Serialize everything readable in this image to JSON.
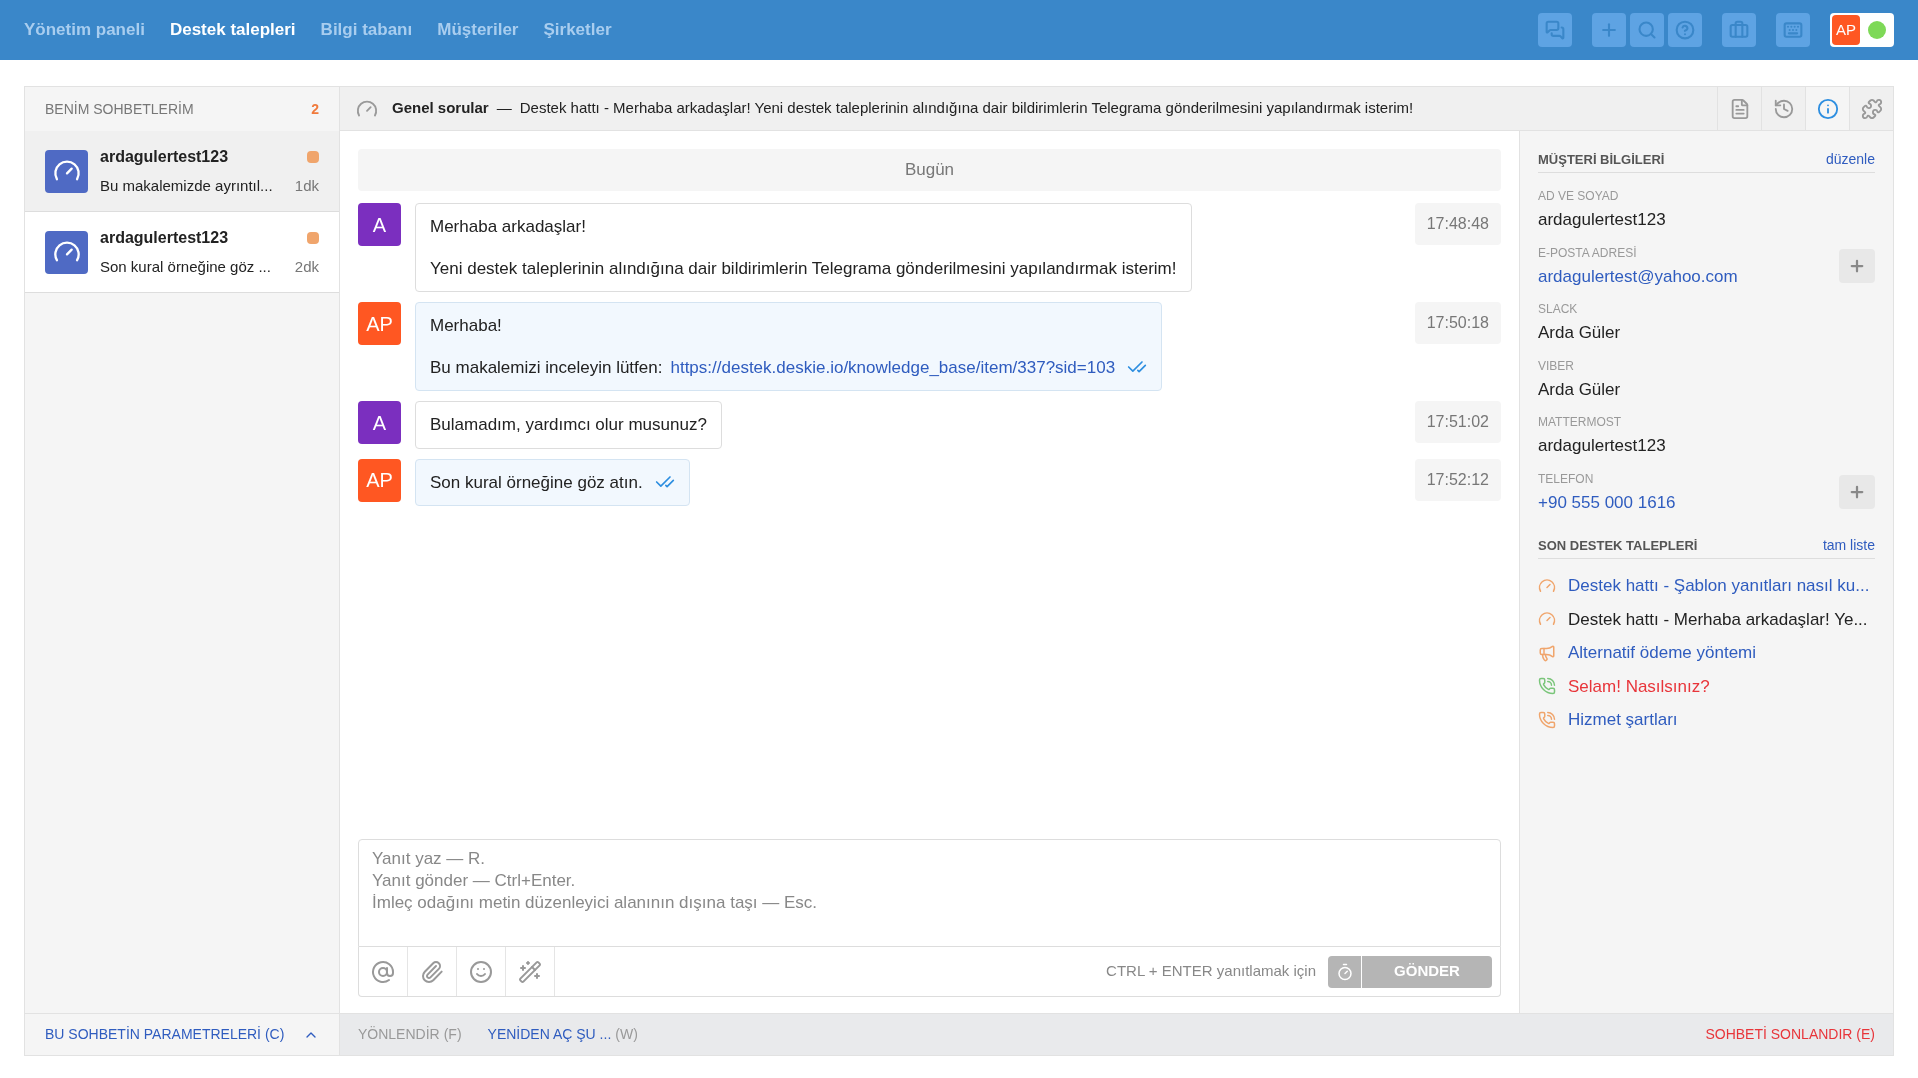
{
  "nav": {
    "items": [
      {
        "label": "Yönetim paneli",
        "selected": false
      },
      {
        "label": "Destek talepleri",
        "selected": true
      },
      {
        "label": "Bilgi tabanı",
        "selected": false
      },
      {
        "label": "Müşteriler",
        "selected": false
      },
      {
        "label": "Şirketler",
        "selected": false
      }
    ],
    "user": {
      "initials": "AP",
      "online": true
    }
  },
  "sidebar": {
    "title": "BENİM SOHBETLERİM",
    "count": "2",
    "chats": [
      {
        "name": "ardagulertest123",
        "preview": "Bu makalemizde ayrıntıl...",
        "time": "1dk",
        "unread": true,
        "selected": false
      },
      {
        "name": "ardagulertest123",
        "preview": "Son kural örneğine göz ...",
        "time": "2dk",
        "unread": true,
        "selected": true
      }
    ]
  },
  "header": {
    "category": "Genel sorular",
    "separator": "—",
    "subject": "Destek hattı - Merhaba arkadaşlar! Yeni destek taleplerinin alındığına dair bildirimlerin Telegrama gönderilmesini yapılandırmak isterim!",
    "panel_tabs": [
      {
        "kind": "document",
        "selected": false
      },
      {
        "kind": "history",
        "selected": false
      },
      {
        "kind": "info",
        "selected": true
      },
      {
        "kind": "plugin",
        "selected": false
      }
    ]
  },
  "chat": {
    "day": "Bugün",
    "messages": [
      {
        "kind": "customer",
        "avatar": "A",
        "paragraphs": [
          {
            "text": "Merhaba arkadaşlar!"
          },
          {
            "text": "Yeni destek taleplerinin alındığına dair bildirimlerin Telegrama gönderilmesini yapılandırmak isterim!"
          }
        ],
        "time": "17:48:48",
        "read": false
      },
      {
        "kind": "agent",
        "avatar": "AP",
        "paragraphs": [
          {
            "text": "Merhaba!"
          },
          {
            "text": "Bu makalemizi inceleyin lütfen:",
            "link": "https://destek.deskie.io/knowledge_base/item/337?sid=103"
          }
        ],
        "time": "17:50:18",
        "read": true
      },
      {
        "kind": "customer",
        "avatar": "A",
        "paragraphs": [
          {
            "text": "Bulamadım, yardımcı olur musunuz?"
          }
        ],
        "time": "17:51:02",
        "read": false
      },
      {
        "kind": "agent",
        "avatar": "AP",
        "paragraphs": [
          {
            "text": "Son kural örneğine göz atın."
          }
        ],
        "time": "17:52:12",
        "read": true
      }
    ]
  },
  "composer": {
    "placeholder": "Yanıt yaz — R.\nYanıt gönder — Ctrl+Enter.\nİmleç odağını metin düzenleyici alanının dışına taşı — Esc.",
    "hint": "CTRL + ENTER yanıtlamak için",
    "send": {
      "label": "GÖNDER",
      "disabled": true
    }
  },
  "customer_info": {
    "title": "MÜŞTERİ BİLGİLERİ",
    "edit": "düzenle",
    "fields": [
      {
        "label": "AD VE SOYAD",
        "value": "ardagulertest123",
        "kind": "text"
      },
      {
        "label": "E-POSTA ADRESİ",
        "value": "ardagulertest@yahoo.com",
        "kind": "link"
      },
      {
        "label": "SLACK",
        "value": "Arda Güler",
        "kind": "text"
      },
      {
        "label": "VIBER",
        "value": "Arda Güler",
        "kind": "text"
      },
      {
        "label": "MATTERMOST",
        "value": "ardagulertest123",
        "kind": "text"
      },
      {
        "label": "TELEFON",
        "value": "+90 555 000 1616",
        "kind": "link"
      }
    ]
  },
  "recent_tickets": {
    "title": "SON DESTEK TALEPLERİ",
    "full_list": "tam liste",
    "items": [
      {
        "kind": "chat",
        "title": "Destek hattı - Şablon yanıtları nasıl ku...",
        "color": "#2f5cbf",
        "active": false
      },
      {
        "kind": "chat",
        "title": "Destek hattı - Merhaba arkadaşlar! Ye...",
        "color": "#222222",
        "active": false
      },
      {
        "kind": "announcement",
        "title": "Alternatif ödeme yöntemi",
        "color": "#2f5cbf",
        "active": false
      },
      {
        "kind": "viber",
        "title": "Selam! Nasılsınız?",
        "color": "#e8353a",
        "active": true
      },
      {
        "kind": "viber",
        "title": "Hizmet şartları",
        "color": "#2f5cbf",
        "active": false
      }
    ]
  },
  "footer": {
    "parameters": {
      "label": "BU SOHBETİN PARAMETRELERİ (C)",
      "expanded": false
    },
    "actions": [
      {
        "label": "YÖNLENDİR",
        "shortcut": "(F)",
        "disabled": true
      },
      {
        "label": "YENİDEN AÇ ŞU ...",
        "shortcut": "(W)",
        "disabled": false
      }
    ],
    "end": {
      "label": "SOHBETİ SONLANDIR (E)"
    }
  }
}
